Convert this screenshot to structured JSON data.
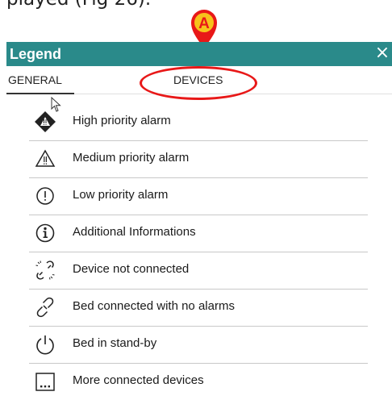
{
  "caption": "played (Fig 26).",
  "marker": {
    "letter": "A",
    "color": "#e81818",
    "fill": "#f7c21b"
  },
  "header": {
    "title": "Legend",
    "close_glyph": "×",
    "color": "#2a8a8a"
  },
  "tabs": [
    {
      "label": "GENERAL",
      "selected": true
    },
    {
      "label": "DEVICES",
      "selected": false
    }
  ],
  "items": [
    {
      "icon": "high-priority-alarm-icon",
      "label": "High priority alarm"
    },
    {
      "icon": "medium-priority-alarm-icon",
      "label": "Medium priority alarm"
    },
    {
      "icon": "low-priority-alarm-icon",
      "label": "Low priority alarm"
    },
    {
      "icon": "info-icon",
      "label": "Additional Informations"
    },
    {
      "icon": "broken-link-icon",
      "label": "Device not connected"
    },
    {
      "icon": "link-icon",
      "label": "Bed connected with no alarms"
    },
    {
      "icon": "power-icon",
      "label": "Bed in stand-by"
    },
    {
      "icon": "more-devices-icon",
      "label": "More connected devices"
    }
  ]
}
